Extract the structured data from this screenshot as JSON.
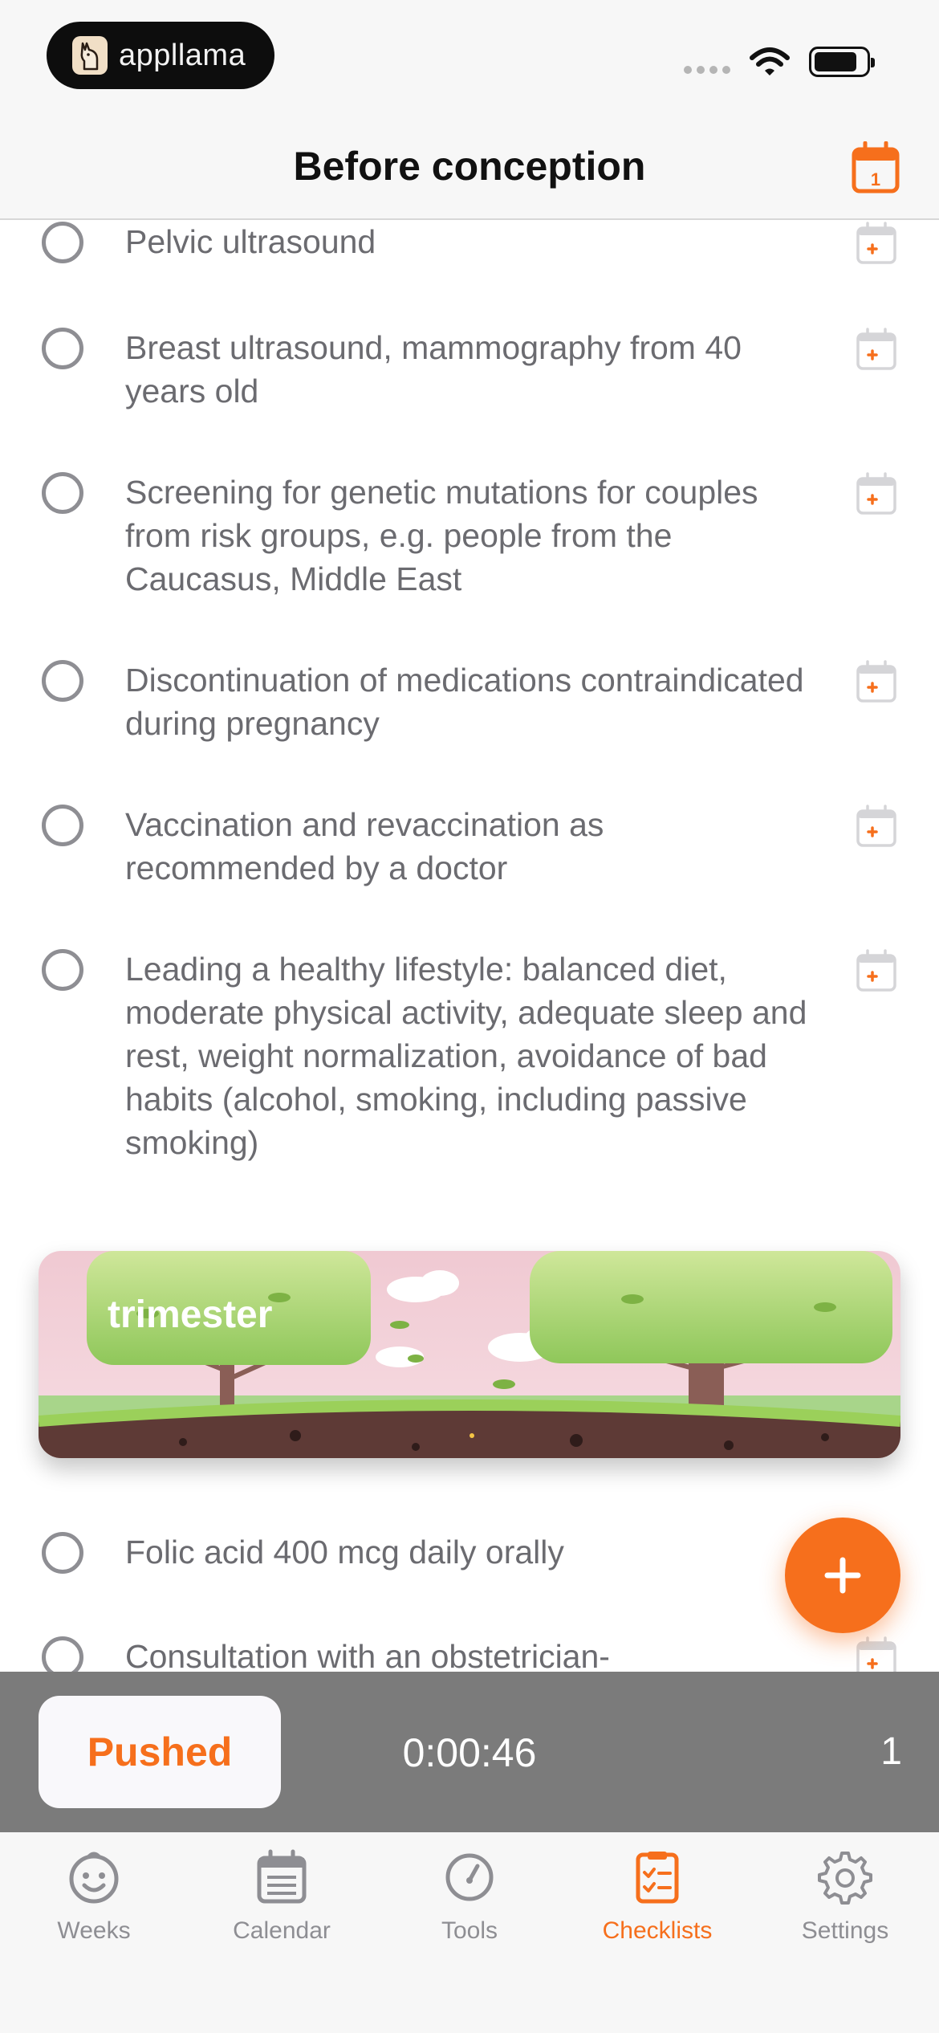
{
  "status": {
    "brand_name": "appllama"
  },
  "nav": {
    "title": "Before conception"
  },
  "checklist": {
    "items": [
      {
        "text": "Pelvic ultrasound"
      },
      {
        "text": "Breast ultrasound, mammography from 40 years old"
      },
      {
        "text": "Screening for genetic mutations for couples from risk groups, e.g. people from the Caucasus, Middle East"
      },
      {
        "text": "Discontinuation of medications contraindicated during pregnancy"
      },
      {
        "text": "Vaccination and revaccination as recommended by a doctor"
      },
      {
        "text": "Leading a healthy lifestyle: balanced diet, moderate physical activity, adequate sleep and rest, weight normalization, avoidance of bad habits (alcohol, smoking, including passive smoking)"
      }
    ],
    "section_title": "trimester",
    "section_items": [
      {
        "text": "Folic acid 400 mcg daily orally"
      },
      {
        "text": "Consultation with an obstetrician-"
      }
    ]
  },
  "timer": {
    "pushed_label": "Pushed",
    "elapsed": "0:00:46",
    "count": "1"
  },
  "tabs": [
    {
      "label": "Weeks",
      "icon": "face-icon"
    },
    {
      "label": "Calendar",
      "icon": "calendar-icon"
    },
    {
      "label": "Tools",
      "icon": "gauge-icon"
    },
    {
      "label": "Checklists",
      "icon": "checklist-icon",
      "active": true
    },
    {
      "label": "Settings",
      "icon": "gear-icon"
    }
  ],
  "colors": {
    "accent": "#f66f1c",
    "timer_bar": "#7b7b7b",
    "text": "#6b6b70"
  }
}
